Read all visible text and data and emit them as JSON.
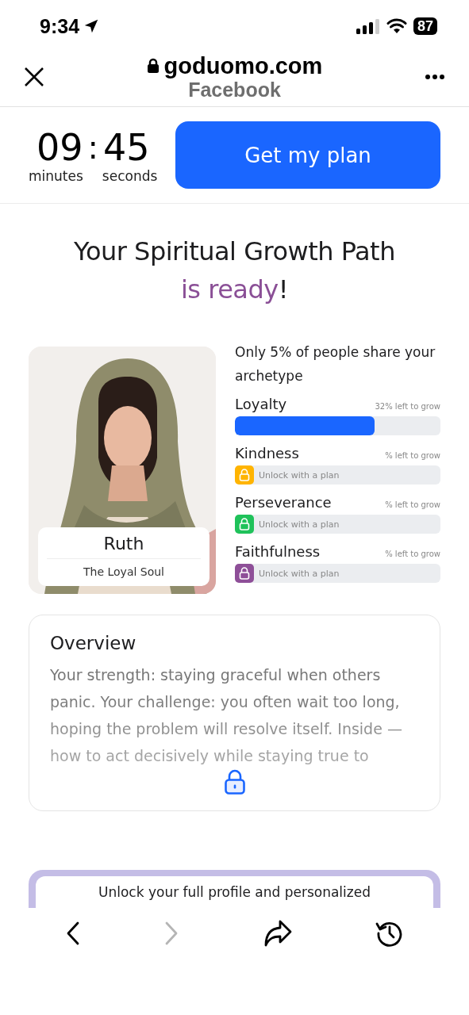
{
  "status_bar": {
    "time": "9:34",
    "battery": "87"
  },
  "browser_header": {
    "domain": "goduomo.com",
    "source": "Facebook"
  },
  "timer": {
    "minutes": "09",
    "separator": ":",
    "seconds": "45",
    "minutes_label": "minutes",
    "seconds_label": "seconds"
  },
  "cta_button": {
    "label": "Get my plan"
  },
  "headline": {
    "line_1": "Your Spiritual Growth Path",
    "highlight": "is ready",
    "end": "!"
  },
  "profile_card": {
    "kind": "picture",
    "name": "Ruth",
    "subtitle": "The Loyal Soul"
  },
  "archetype": {
    "note": "Only 5% of people share your archetype",
    "traits": [
      {
        "kind": "progress",
        "name": "Loyalty",
        "reading": "32% left to grow",
        "level": 0.68
      },
      {
        "kind": "locked",
        "name": "Kindness",
        "reading": "% left to grow",
        "lock_text": "Unlock with a plan",
        "color": "#ffb400"
      },
      {
        "kind": "locked",
        "name": "Perseverance",
        "reading": "% left to grow",
        "lock_text": "Unlock with a plan",
        "color": "#1fc25a"
      },
      {
        "kind": "locked",
        "name": "Faithfulness",
        "reading": "% left to grow",
        "lock_text": "Unlock with a plan",
        "color": "#8e4f98"
      }
    ]
  },
  "overview": {
    "title": "Overview",
    "text": "Your strength: staying graceful when others panic. Your challenge: you often wait too long, hoping the problem will resolve itself. Inside — how to act decisively while staying true to"
  },
  "unlock_card": {
    "text": "Unlock your full profile and personalized"
  },
  "toolbar": [
    {
      "kind": "back",
      "disabled": false
    },
    {
      "kind": "forward",
      "disabled": true
    },
    {
      "kind": "share",
      "disabled": false
    },
    {
      "kind": "history",
      "disabled": false
    }
  ]
}
